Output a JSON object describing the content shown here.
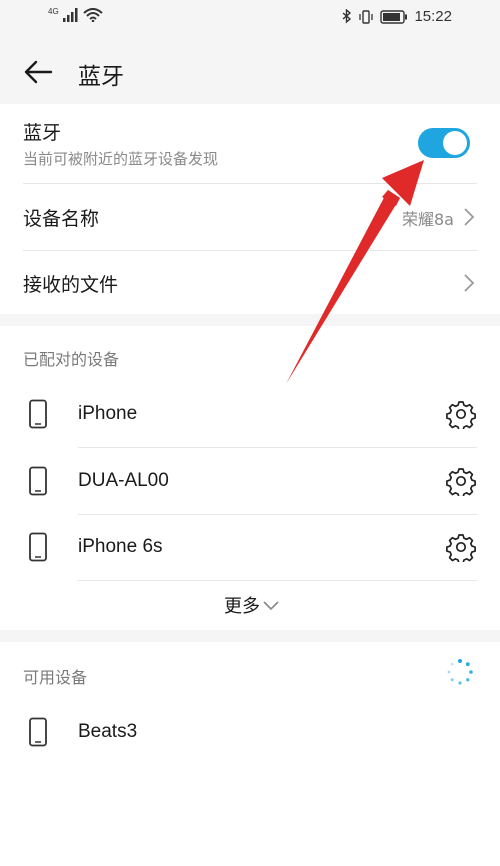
{
  "status_bar": {
    "network_label": "4G",
    "time": "15:22"
  },
  "header": {
    "title": "蓝牙"
  },
  "bluetooth": {
    "label": "蓝牙",
    "subtitle": "当前可被附近的蓝牙设备发现",
    "enabled": true,
    "accent_color": "#1fa6e0"
  },
  "device_name": {
    "label": "设备名称",
    "value": "荣耀8a"
  },
  "received_files": {
    "label": "接收的文件"
  },
  "paired": {
    "heading": "已配对的设备",
    "devices": [
      {
        "name": "iPhone",
        "icon": "phone-icon",
        "action_icon": "gear-icon"
      },
      {
        "name": "DUA-AL00",
        "icon": "phone-icon",
        "action_icon": "gear-icon"
      },
      {
        "name": "iPhone 6s",
        "icon": "phone-icon",
        "action_icon": "gear-icon"
      }
    ],
    "more_label": "更多"
  },
  "available": {
    "heading": "可用设备",
    "scanning_icon": "spinner-icon",
    "devices": [
      {
        "name": "Beats3",
        "icon": "phone-icon"
      }
    ]
  },
  "annotation": {
    "arrow_color": "#e02a2a"
  }
}
